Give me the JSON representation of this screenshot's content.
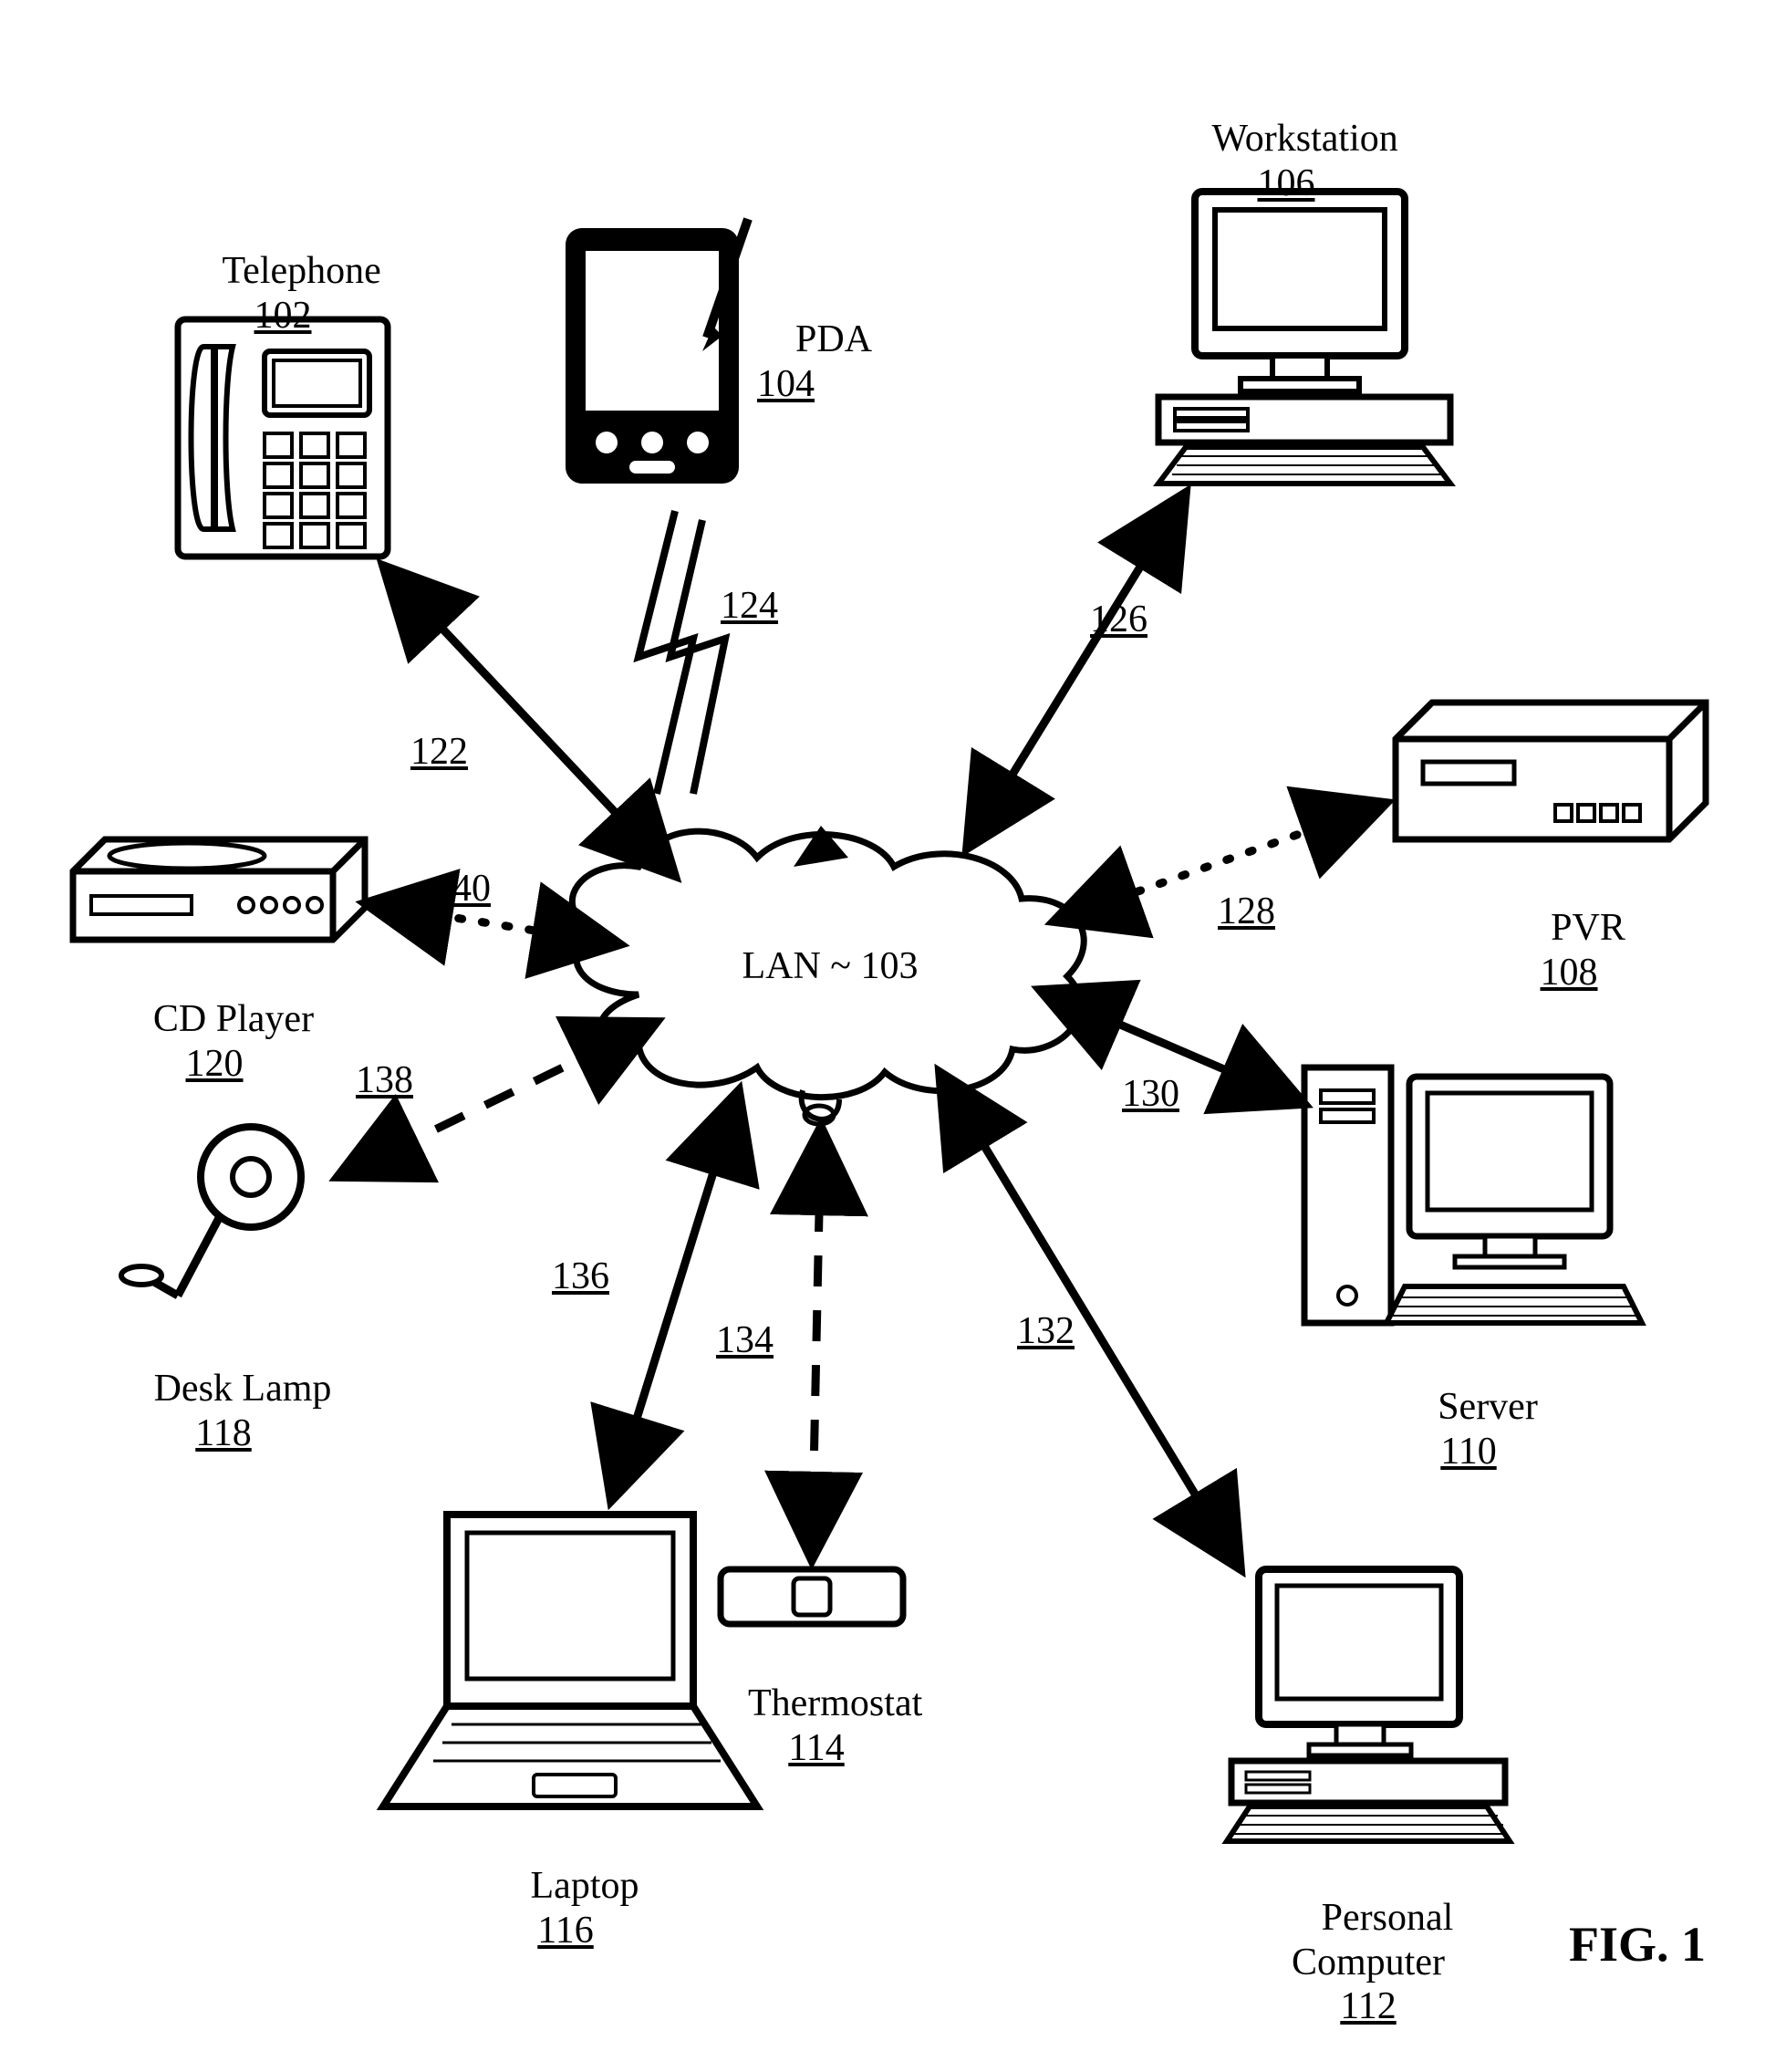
{
  "figure": "FIG. 1",
  "cloud": {
    "label": "LAN ~ 103"
  },
  "nodes": {
    "telephone": {
      "name": "Telephone",
      "ref": "102"
    },
    "pda": {
      "name": "PDA",
      "ref": "104"
    },
    "workstation": {
      "name": "Workstation",
      "ref": "106"
    },
    "pvr": {
      "name": "PVR",
      "ref": "108"
    },
    "server": {
      "name": "Server",
      "ref": "110"
    },
    "pc": {
      "name": "Personal\nComputer",
      "ref": "112"
    },
    "thermostat": {
      "name": "Thermostat",
      "ref": "114"
    },
    "laptop": {
      "name": "Laptop",
      "ref": "116"
    },
    "desklamp": {
      "name": "Desk Lamp",
      "ref": "118"
    },
    "cdplayer": {
      "name": "CD Player",
      "ref": "120"
    }
  },
  "connections": {
    "telephone": "122",
    "pda": "124",
    "workstation": "126",
    "pvr": "128",
    "server": "130",
    "pc": "132",
    "thermostat": "134",
    "laptop": "136",
    "desklamp": "138",
    "cdplayer": "140"
  }
}
